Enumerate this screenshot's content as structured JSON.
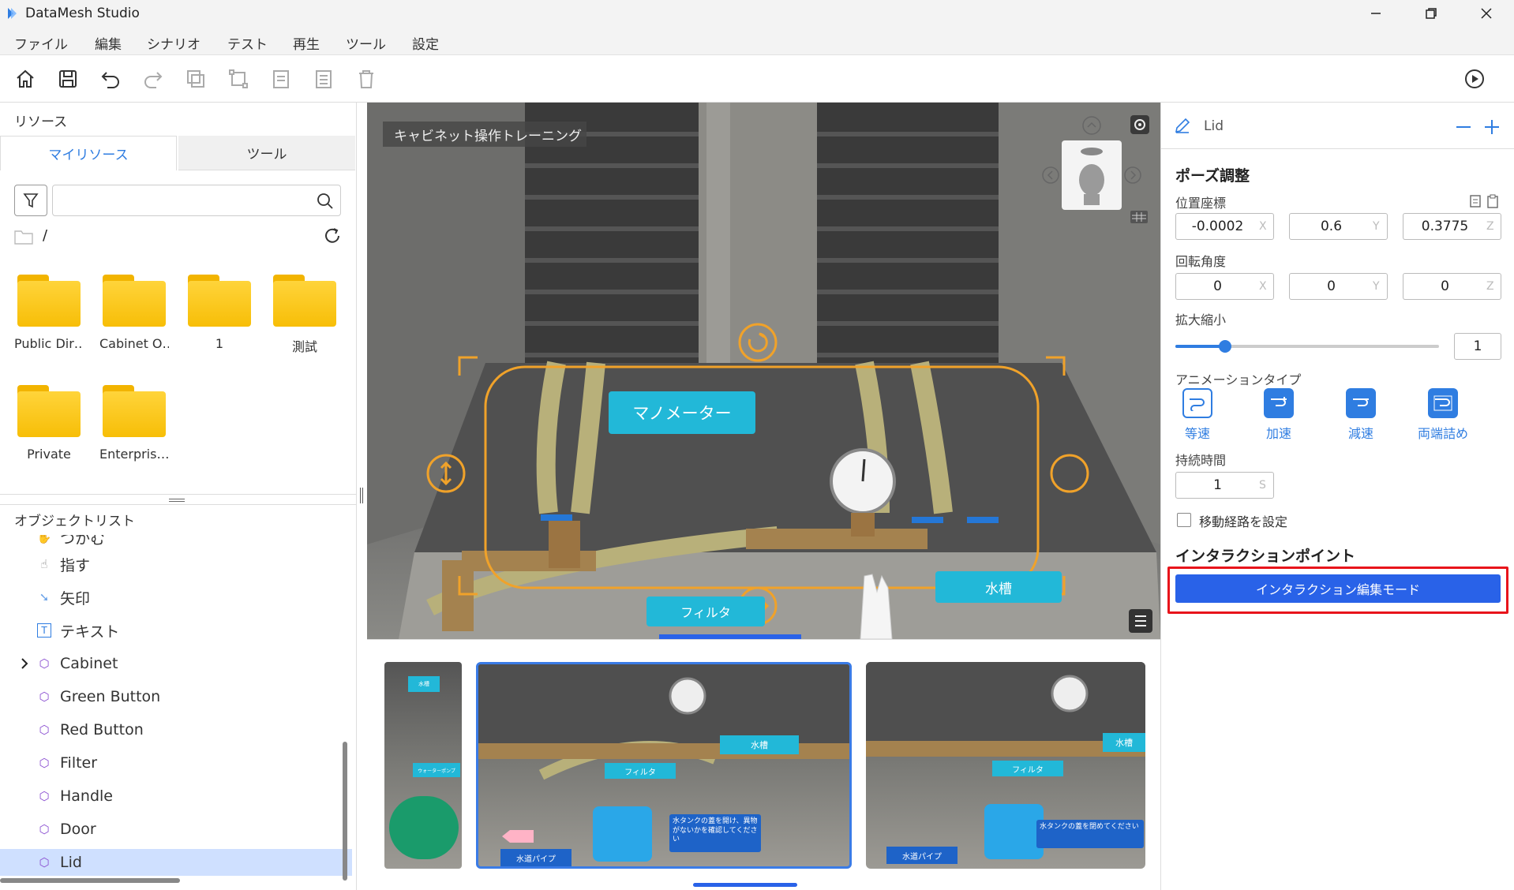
{
  "app": {
    "title": "DataMesh Studio"
  },
  "menu": [
    "ファイル",
    "編集",
    "シナリオ",
    "テスト",
    "再生",
    "ツール",
    "設定"
  ],
  "toolbar": {
    "icons": [
      "home-icon",
      "save-icon",
      "undo-icon",
      "redo-icon",
      "copy-icon",
      "group-icon",
      "paste-icon",
      "list-icon",
      "delete-icon",
      "play-icon"
    ]
  },
  "resources": {
    "title": "リソース",
    "tabs": [
      "マイリソース",
      "ツール"
    ],
    "path": "/",
    "folders": [
      "Public Dir…",
      "Cabinet O…",
      "1",
      "測試",
      "Private",
      "Enterpris…"
    ]
  },
  "objects": {
    "title": "オブジェクトリスト",
    "items": [
      {
        "label": "つかむ",
        "icon": "hand-grab-icon"
      },
      {
        "label": "指す",
        "icon": "hand-point-icon"
      },
      {
        "label": "矢印",
        "icon": "arrow-icon"
      },
      {
        "label": "テキスト",
        "icon": "text-icon"
      },
      {
        "label": "Cabinet",
        "icon": "cube-icon"
      },
      {
        "label": "Green Button",
        "icon": "cube-icon"
      },
      {
        "label": "Red Button",
        "icon": "cube-icon"
      },
      {
        "label": "Filter",
        "icon": "cube-icon"
      },
      {
        "label": "Handle",
        "icon": "cube-icon"
      },
      {
        "label": "Door",
        "icon": "cube-icon"
      },
      {
        "label": "Lid",
        "icon": "cube-icon"
      }
    ],
    "selected": "Lid"
  },
  "viewport": {
    "scene_title": "キャビネット操作トレーニング",
    "labels": {
      "manometer": "マノメーター",
      "filter": "フィルタ",
      "tank": "水槽"
    }
  },
  "thumbnails": {
    "labels": {
      "pump": "ウォーターポンプ",
      "tank": "水槽",
      "filter": "フィルタ",
      "pipe": "水道パイプ",
      "instruction1": "水タンクの蓋を開け、異物がないかを確認してください",
      "instruction2": "水タンクの蓋を閉めてください"
    }
  },
  "inspector": {
    "object_name": "Lid",
    "pose_title": "ポーズ調整",
    "position_label": "位置座標",
    "position": {
      "x": "-0.0002",
      "y": "0.6",
      "z": "0.3775"
    },
    "rotation_label": "回転角度",
    "rotation": {
      "x": "0",
      "y": "0",
      "z": "0"
    },
    "scale_label": "拡大縮小",
    "scale": "1",
    "scale_slider": 0.19,
    "axes": [
      "X",
      "Y",
      "Z"
    ],
    "anim_label": "アニメーションタイプ",
    "anim_types": [
      "等速",
      "加速",
      "減速",
      "両端詰め"
    ],
    "duration_label": "持続時間",
    "duration": "1",
    "duration_unit": "S",
    "path_checkbox": "移動経路を設定",
    "interaction_title": "インタラクションポイント",
    "interaction_button": "インタラクション編集モード"
  }
}
